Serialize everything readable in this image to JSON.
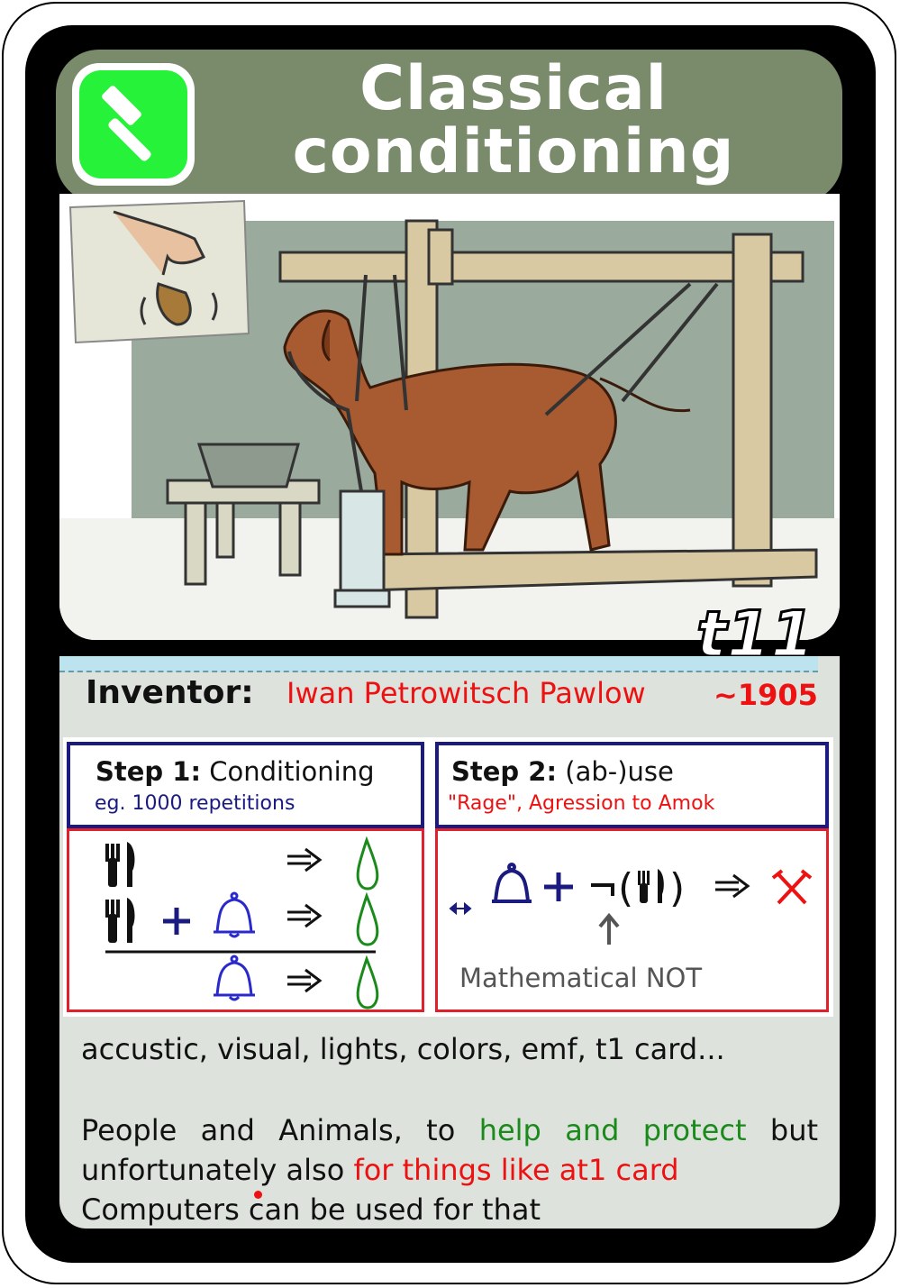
{
  "card": {
    "title_line1": "Classical",
    "title_line2": "conditioning",
    "code": "t11",
    "icon": "hammer-icon",
    "colors": {
      "title_bar": "#7a8b6b",
      "icon_bg": "#26f23a",
      "accent_red": "#e11111",
      "step_border": "#1a1a80"
    }
  },
  "inventor": {
    "label": "Inventor:",
    "name": "Iwan Petrowitsch Pawlow",
    "year": "~1905"
  },
  "step1": {
    "title_bold": "Step 1:",
    "title_rest": " Conditioning",
    "subtitle": "eg. 1000 repetitions",
    "icons": [
      "fork-knife-icon",
      "plus-icon",
      "bell-icon",
      "arrow-right-icon",
      "drop-icon"
    ]
  },
  "step2": {
    "title_bold": "Step 2:",
    "title_rest": " (ab-)use",
    "subtitle": "\"Rage\", Agression to Amok",
    "not_label": "Mathematical NOT",
    "icons": [
      "bell-icon",
      "plus-icon",
      "not-icon",
      "fork-knife-icon",
      "arrow-right-icon",
      "crossed-swords-icon"
    ]
  },
  "text": {
    "line1": "accustic, visual, lights, colors, emf, t1 card...",
    "p1": "People and Animals, to ",
    "p1_green": "help and protect",
    "p1_end": " but",
    "p2": "unfortunately also ",
    "p2_red": "for things like at1 card",
    "p3": "Computers can be used for that"
  }
}
